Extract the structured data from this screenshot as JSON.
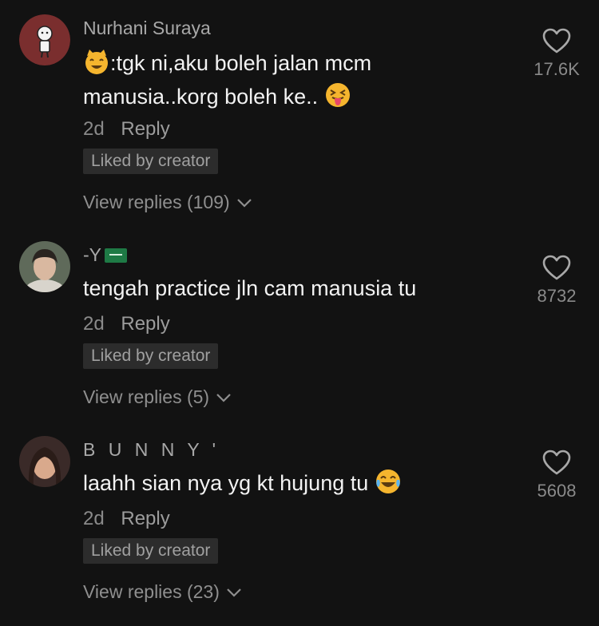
{
  "comments": [
    {
      "username": "Nurhani Suraya",
      "text_line1": ":tgk ni,aku boleh jalan mcm",
      "text_line2": "manusia..korg boleh ke..",
      "time": "2d",
      "reply_label": "Reply",
      "badge": "Liked by creator",
      "view_replies": "View replies (109)",
      "likes": "17.6K"
    },
    {
      "username": "-Y",
      "text_line1": "tengah practice jln cam manusia tu",
      "time": "2d",
      "reply_label": "Reply",
      "badge": "Liked by creator",
      "view_replies": "View replies (5)",
      "likes": "8732"
    },
    {
      "username": "B U N N Y '",
      "text_line1": "laahh sian nya yg kt hujung tu",
      "time": "2d",
      "reply_label": "Reply",
      "badge": "Liked by creator",
      "view_replies": "View replies (23)",
      "likes": "5608"
    }
  ],
  "colors": {
    "background": "#121212",
    "text_primary": "#f2f2f2",
    "text_secondary": "#8a8a8a",
    "badge_bg": "#2c2c2c"
  },
  "icons": [
    "heart-outline-icon",
    "chevron-down-icon",
    "cat-emoji-icon",
    "tongue-emoji-icon",
    "laughing-emoji-icon",
    "saudi-flag-icon"
  ]
}
